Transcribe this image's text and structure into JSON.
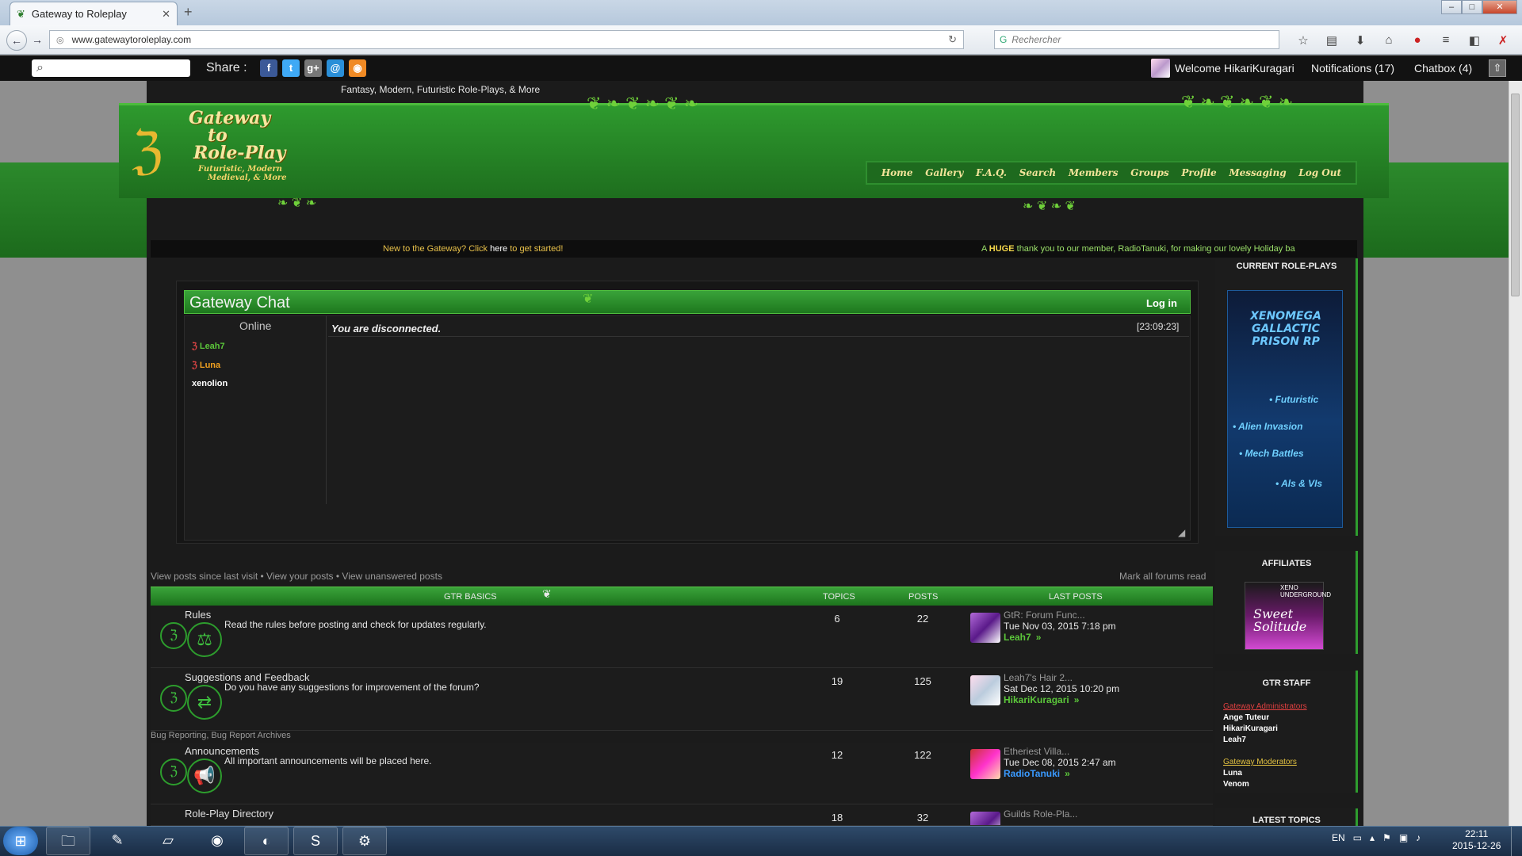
{
  "browser": {
    "tab_title": "Gateway to Roleplay",
    "url": "www.gatewaytoroleplay.com",
    "search_placeholder": "Rechercher"
  },
  "site_top": {
    "share_label": "Share :",
    "welcome": "Welcome HikariKuragari",
    "notifications": "Notifications  (17)",
    "chatbox": "Chatbox (4)"
  },
  "header": {
    "tagline": "Fantasy, Modern, Futuristic Role-Plays, & More",
    "logo_line1": "Gateway",
    "logo_line2": "to",
    "logo_line3": "Role-Play",
    "logo_sub1": "Futuristic, Modern",
    "logo_sub2": "Medieval, & More",
    "nav": [
      "Home",
      "Gallery",
      "F.A.Q.",
      "Search",
      "Members",
      "Groups",
      "Profile",
      "Messaging",
      "Log Out"
    ]
  },
  "announce": {
    "left_pre": "New to the Gateway? Click ",
    "left_link": "here",
    "left_post": " to get started!",
    "right_pre": "A ",
    "right_bold": "HUGE",
    "right_post": " thank you to our member, RadioTanuki, for making our lovely Holiday ba"
  },
  "chat": {
    "title": "Gateway Chat",
    "login": "Log in",
    "online_header": "Online",
    "users": [
      {
        "name": "Leah7",
        "color": "#5bc63a"
      },
      {
        "name": "Luna",
        "color": "#f0a020"
      },
      {
        "name": "xenolion",
        "color": "#ffffff"
      }
    ],
    "message": "You are disconnected.",
    "time": "[23:09:23]"
  },
  "forum": {
    "view_links": [
      "View posts since last visit",
      "View your posts",
      "View unanswered posts"
    ],
    "mark_all": "Mark all forums read",
    "columns": {
      "section": "GTR BASICS",
      "topics": "TOPICS",
      "posts": "POSTS",
      "last": "LAST POSTS"
    },
    "rows": [
      {
        "title": "Rules",
        "desc": "Read the rules before posting and check for updates regularly.",
        "topics": "6",
        "posts": "22",
        "lp_title": "GtR: Forum Func...",
        "lp_date": "Tue Nov 03, 2015 7:18 pm",
        "lp_user": "Leah7",
        "lp_color": "#5bc63a"
      },
      {
        "title": "Suggestions and Feedback",
        "desc": "Do you have any suggestions for improvement of the forum?",
        "topics": "19",
        "posts": "125",
        "lp_title": "Leah7's Hair 2...",
        "lp_date": "Sat Dec 12, 2015 10:20 pm",
        "lp_user": "HikariKuragari",
        "lp_color": "#5bc63a"
      },
      {
        "title": "Announcements",
        "desc": "All important announcements will be placed here.",
        "topics": "12",
        "posts": "122",
        "lp_title": "Etheriest Villa...",
        "lp_date": "Tue Dec 08, 2015 2:47 am",
        "lp_user": "RadioTanuki",
        "lp_color": "#3a9aff"
      },
      {
        "title": "Role-Play Directory",
        "desc": "",
        "topics": "18",
        "posts": "32",
        "lp_title": "Guilds Role-Pla...",
        "lp_date": "",
        "lp_user": "",
        "lp_color": "#5bc63a"
      }
    ],
    "subforums": "Bug Reporting, Bug Report Archives"
  },
  "sidebar": {
    "current_rp": "CURRENT ROLE-PLAYS",
    "rp_banner_title": "XENOMEGA GALLACTIC PRISON RP",
    "rp_banner_items": [
      "• Futuristic",
      "• Alien Invasion",
      "• Mech Battles",
      "• Als & VIs"
    ],
    "affiliates": "AFFILIATES",
    "affil_text1": "XENO UNDERGROUND",
    "affil_text2": "Sweet Solitude",
    "staff_header": "GTR STAFF",
    "admins_label": "Gateway Administrators",
    "admins": [
      "Ange Tuteur",
      "HikariKuragari",
      "Leah7"
    ],
    "mods_label": "Gateway Moderators",
    "mods": [
      "Luna",
      "Venom"
    ],
    "latest": "LATEST TOPICS",
    "admin_color": "#e04040",
    "mod_color": "#e0c040"
  },
  "taskbar": {
    "lang": "EN",
    "time": "22:11",
    "date": "2015-12-26"
  }
}
